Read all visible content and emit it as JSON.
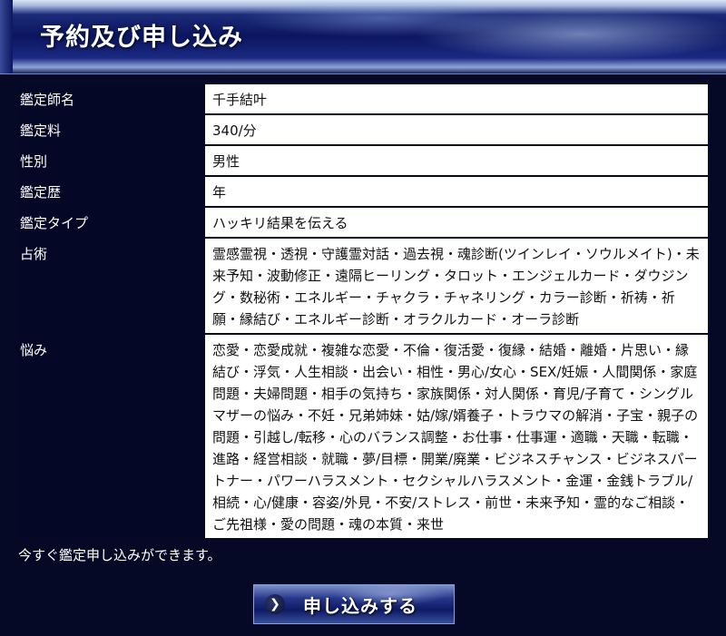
{
  "header": {
    "title": "予約及び申し込み"
  },
  "rows": [
    {
      "label": "鑑定師名",
      "value": "千手結叶"
    },
    {
      "label": "鑑定料",
      "value": "340/分"
    },
    {
      "label": "性別",
      "value": "男性"
    },
    {
      "label": "鑑定歴",
      "value": "年"
    },
    {
      "label": "鑑定タイプ",
      "value": "ハッキリ結果を伝える"
    },
    {
      "label": "占術",
      "value": "霊感霊視・透視・守護霊対話・過去視・魂診断(ツインレイ・ソウルメイト)・未来予知・波動修正・遠隔ヒーリング・タロット・エンジェルカード・ダウジング・数秘術・エネルギー・チャクラ・チャネリング・カラー診断・祈祷・祈願・縁結び・エネルギー診断・オラクルカード・オーラ診断"
    },
    {
      "label": "悩み",
      "value": "恋愛・恋愛成就・複雑な恋愛・不倫・復活愛・復縁・結婚・離婚・片思い・縁結び・浮気・人生相談・出会い・相性・男心/女心・SEX/妊娠・人間関係・家庭問題・夫婦問題・相手の気持ち・家族関係・対人関係・育児/子育て・シングルマザーの悩み・不妊・兄弟姉妹・姑/嫁/婿養子・トラウマの解消・子宝・親子の問題・引越し/転移・心のバランス調整・お仕事・仕事運・適職・天職・転職・進路・経営相談・就職・夢/目標・開業/廃業・ビジネスチャンス・ビジネスパートナー・パワーハラスメント・セクシャルハラスメント・金運・金銭トラブル/相続・心/健康・容姿/外見・不安/ストレス・前世・未来予知・霊的なご相談・ご先祖様・愛の問題・魂の本質・来世"
    }
  ],
  "notice": "今すぐ鑑定申し込みができます。",
  "apply_button": {
    "icon": "chevron-right-icon",
    "label": "申し込みする"
  }
}
